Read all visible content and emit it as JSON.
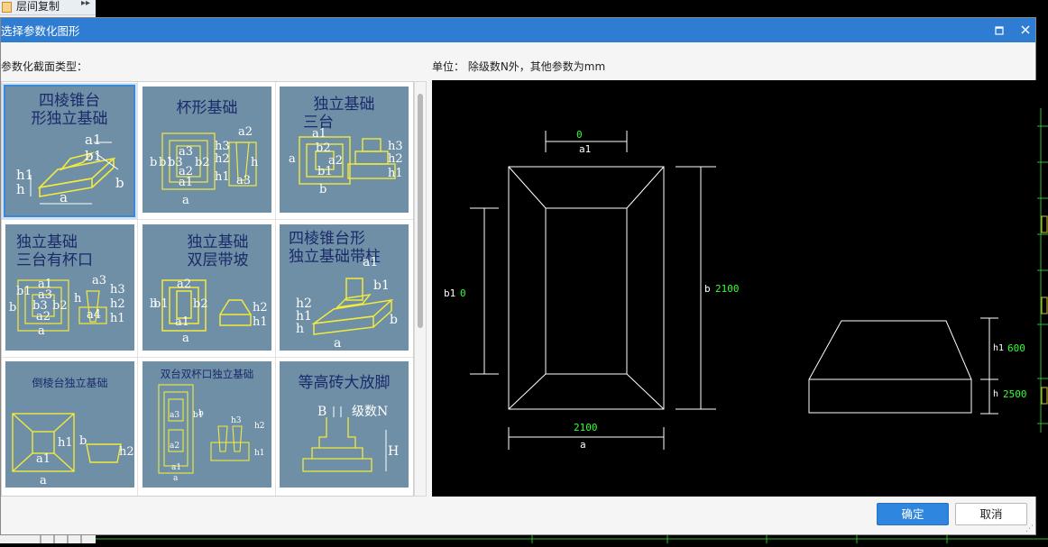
{
  "background": {
    "menu_item": "层间复制",
    "menu_arrow": "▸▸"
  },
  "dialog": {
    "title": "选择参数化图形",
    "section_type_label": "参数化截面类型：",
    "unit_label": "单位：  除级数N外，其他参数为mm",
    "buttons": {
      "ok": "确定",
      "cancel": "取消"
    }
  },
  "thumbnails": [
    {
      "title1": "四棱锥台",
      "title2": "形独立基础",
      "selected": true,
      "labels": [
        "a1",
        "b1",
        "h1",
        "h",
        "a",
        "b"
      ]
    },
    {
      "title1": "杯形基础",
      "title2": "",
      "selected": false,
      "labels": [
        "a2",
        "a3",
        "b3",
        "a2",
        "a1",
        "b2",
        "b1",
        "b",
        "h3",
        "h2",
        "h1",
        "h",
        "a3",
        "a"
      ]
    },
    {
      "title1": "独立基础",
      "title2": "三台",
      "selected": false,
      "labels": [
        "a1",
        "b2",
        "a2",
        "b1",
        "h3",
        "h2",
        "h1",
        "a",
        "b"
      ]
    },
    {
      "title1": "独立基础",
      "title2": "三台有杯口",
      "selected": false,
      "labels": [
        "a1",
        "a3",
        "b1",
        "b3",
        "b2",
        "a2",
        "a",
        "h3",
        "h2",
        "h1",
        "h",
        "a3",
        "a4",
        "b"
      ]
    },
    {
      "title1": "独立基础",
      "title2": "双层带坡",
      "selected": false,
      "labels": [
        "a2",
        "b1",
        "b2",
        "a1",
        "a",
        "h2",
        "h1",
        "b"
      ]
    },
    {
      "title1": "四棱锥台形",
      "title2": "独立基础带柱",
      "selected": false,
      "labels": [
        "a1",
        "b1",
        "h2",
        "h1",
        "h",
        "a",
        "b"
      ]
    },
    {
      "title1": "倒棱台独立基础",
      "title2": "",
      "selected": false,
      "labels": [
        "h1",
        "a1",
        "a",
        "b",
        "h2"
      ]
    },
    {
      "title1": "双台双杯口独立基础",
      "title2": "",
      "selected": false,
      "labels": [
        "a3",
        "a2",
        "b1",
        "b",
        "a1",
        "a",
        "h3",
        "h2",
        "h1"
      ]
    },
    {
      "title1": "等高砖大放脚",
      "title2": "",
      "selected": false,
      "labels": [
        "B",
        "级数N",
        "H"
      ]
    }
  ],
  "preview": {
    "plan": {
      "a1_label": "a1",
      "a1_value": "0",
      "b1_label": "b1",
      "b1_value": "0",
      "b_label": "b",
      "b_value": "2100",
      "a_label": "a",
      "a_value": "2100"
    },
    "section": {
      "h1_label": "h1",
      "h1_value": "600",
      "h_label": "h",
      "h_value": "2500"
    },
    "colors": {
      "line": "#ffffff",
      "value": "#33ff33",
      "label": "#ffffff"
    }
  }
}
